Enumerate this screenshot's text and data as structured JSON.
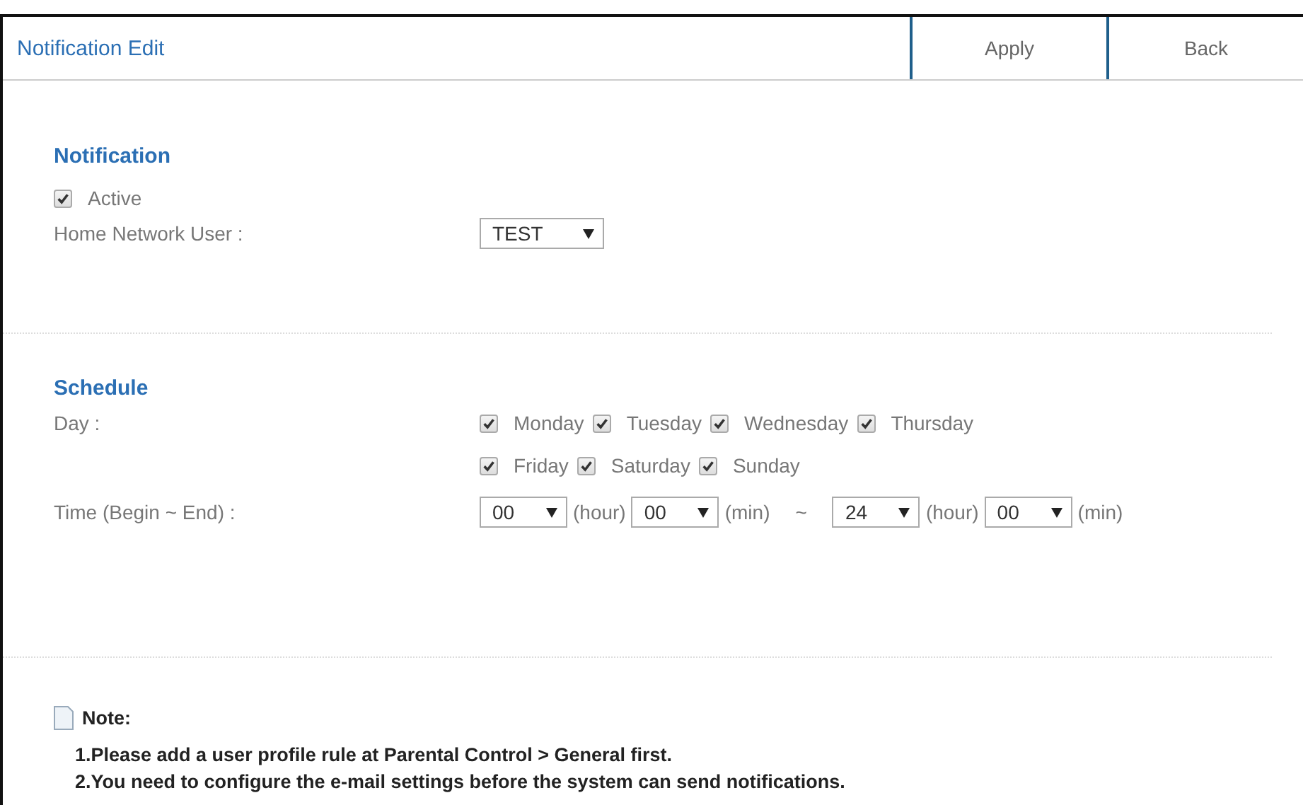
{
  "header": {
    "title": "Notification Edit",
    "buttons": [
      "Apply",
      "Back"
    ]
  },
  "notification": {
    "heading": "Notification",
    "active": {
      "label": "Active",
      "checked": true
    },
    "user": {
      "label": "Home Network User :",
      "value": "TEST"
    }
  },
  "schedule": {
    "heading": "Schedule",
    "day_label": "Day :",
    "day_rows": [
      [
        {
          "label": "Monday",
          "checked": true
        },
        {
          "label": "Tuesday",
          "checked": true
        },
        {
          "label": "Wednesday",
          "checked": true
        },
        {
          "label": "Thursday",
          "checked": true
        }
      ],
      [
        {
          "label": "Friday",
          "checked": true
        },
        {
          "label": "Saturday",
          "checked": true
        },
        {
          "label": "Sunday",
          "checked": true
        }
      ]
    ],
    "time_label": "Time (Begin ~ End) :",
    "time": [
      {
        "kind": "select",
        "value": "00"
      },
      {
        "kind": "unit",
        "text": "(hour)"
      },
      {
        "kind": "select",
        "value": "00"
      },
      {
        "kind": "unit",
        "text": "(min)"
      },
      {
        "kind": "separator",
        "text": "~"
      },
      {
        "kind": "select",
        "value": "24"
      },
      {
        "kind": "unit",
        "text": "(hour)"
      },
      {
        "kind": "select",
        "value": "00"
      },
      {
        "kind": "unit",
        "text": "(min)"
      }
    ]
  },
  "note": {
    "title": "Note:",
    "items": [
      "1.Please add a user profile rule at Parental Control > General first.",
      "2.You need to configure the e-mail settings before the system can send notifications."
    ]
  }
}
